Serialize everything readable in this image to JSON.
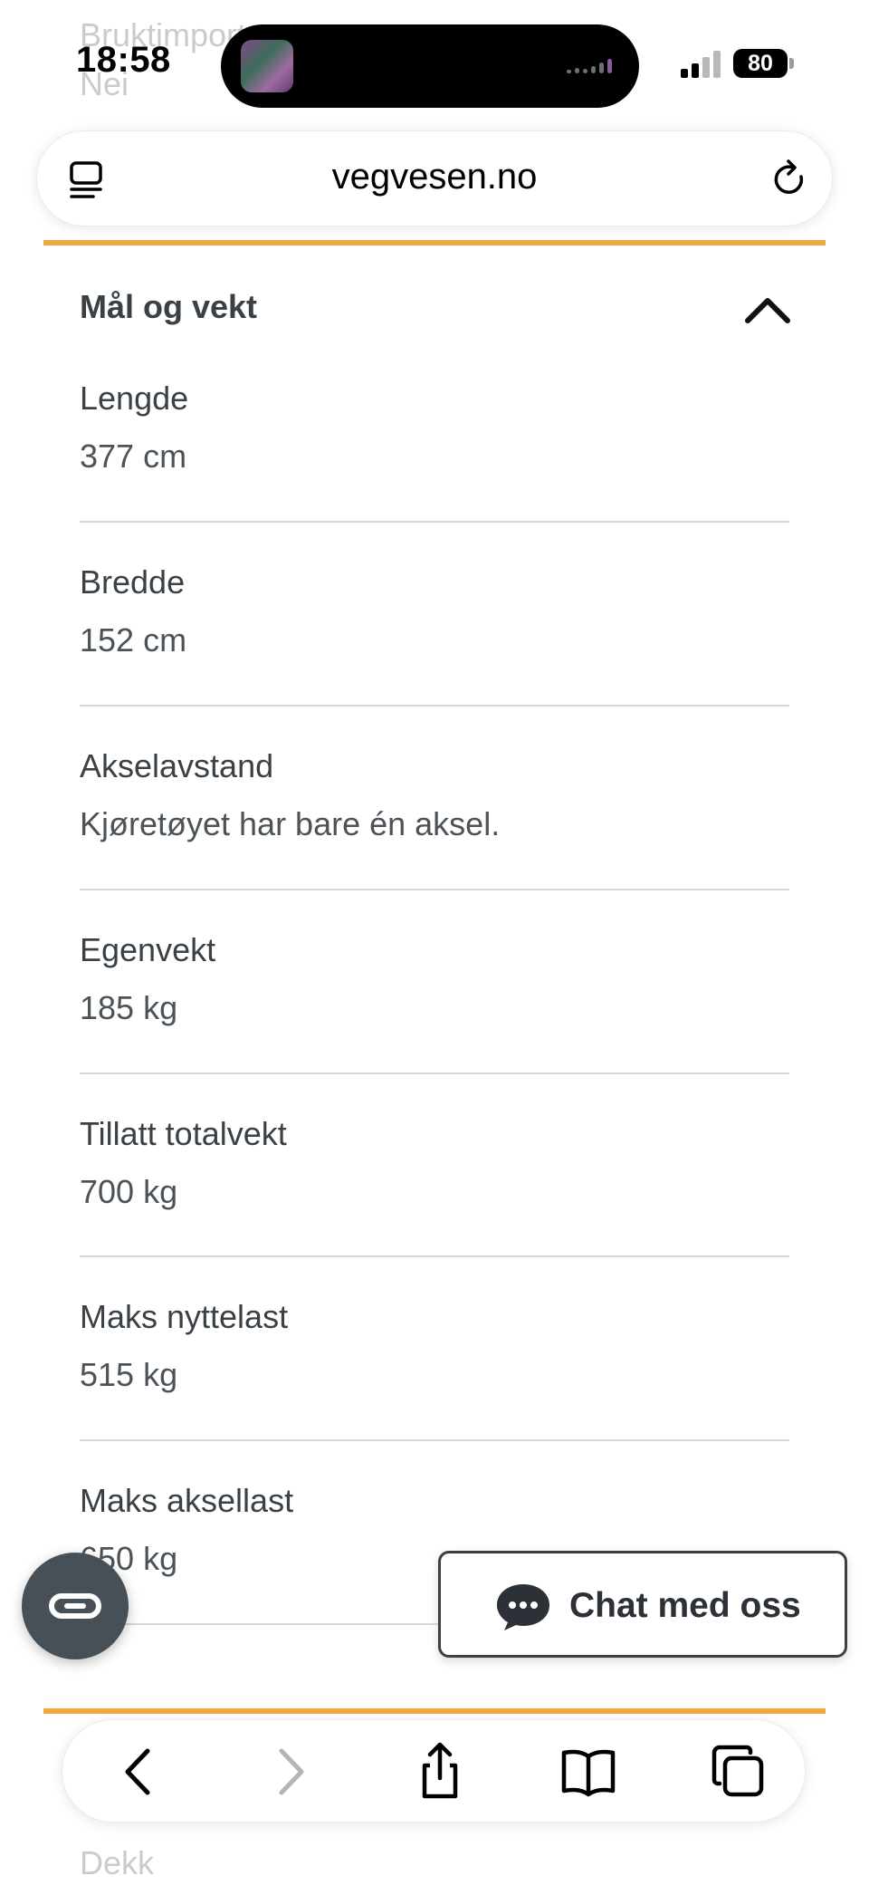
{
  "ghost_top": {
    "label": "Bruktimportert",
    "value": "Nei"
  },
  "status_bar": {
    "time": "18:58",
    "battery": "80"
  },
  "browser": {
    "url": "vegvesen.no"
  },
  "section": {
    "title": "Mål og vekt",
    "fields": [
      {
        "label": "Lengde",
        "value": "377 cm"
      },
      {
        "label": "Bredde",
        "value": "152 cm"
      },
      {
        "label": "Akselavstand",
        "value": "Kjøretøyet har bare én aksel."
      },
      {
        "label": "Egenvekt",
        "value": "185 kg"
      },
      {
        "label": "Tillatt totalvekt",
        "value": "700 kg"
      },
      {
        "label": "Maks nyttelast",
        "value": "515 kg"
      },
      {
        "label": "Maks aksellast",
        "value": "650 kg"
      }
    ]
  },
  "chat": {
    "label": "Chat med oss"
  },
  "ghost_bottom": {
    "label": "Dekk"
  },
  "colors": {
    "accent": "#f0a83c",
    "text": "#3a4146",
    "cobrowse": "#465056"
  }
}
